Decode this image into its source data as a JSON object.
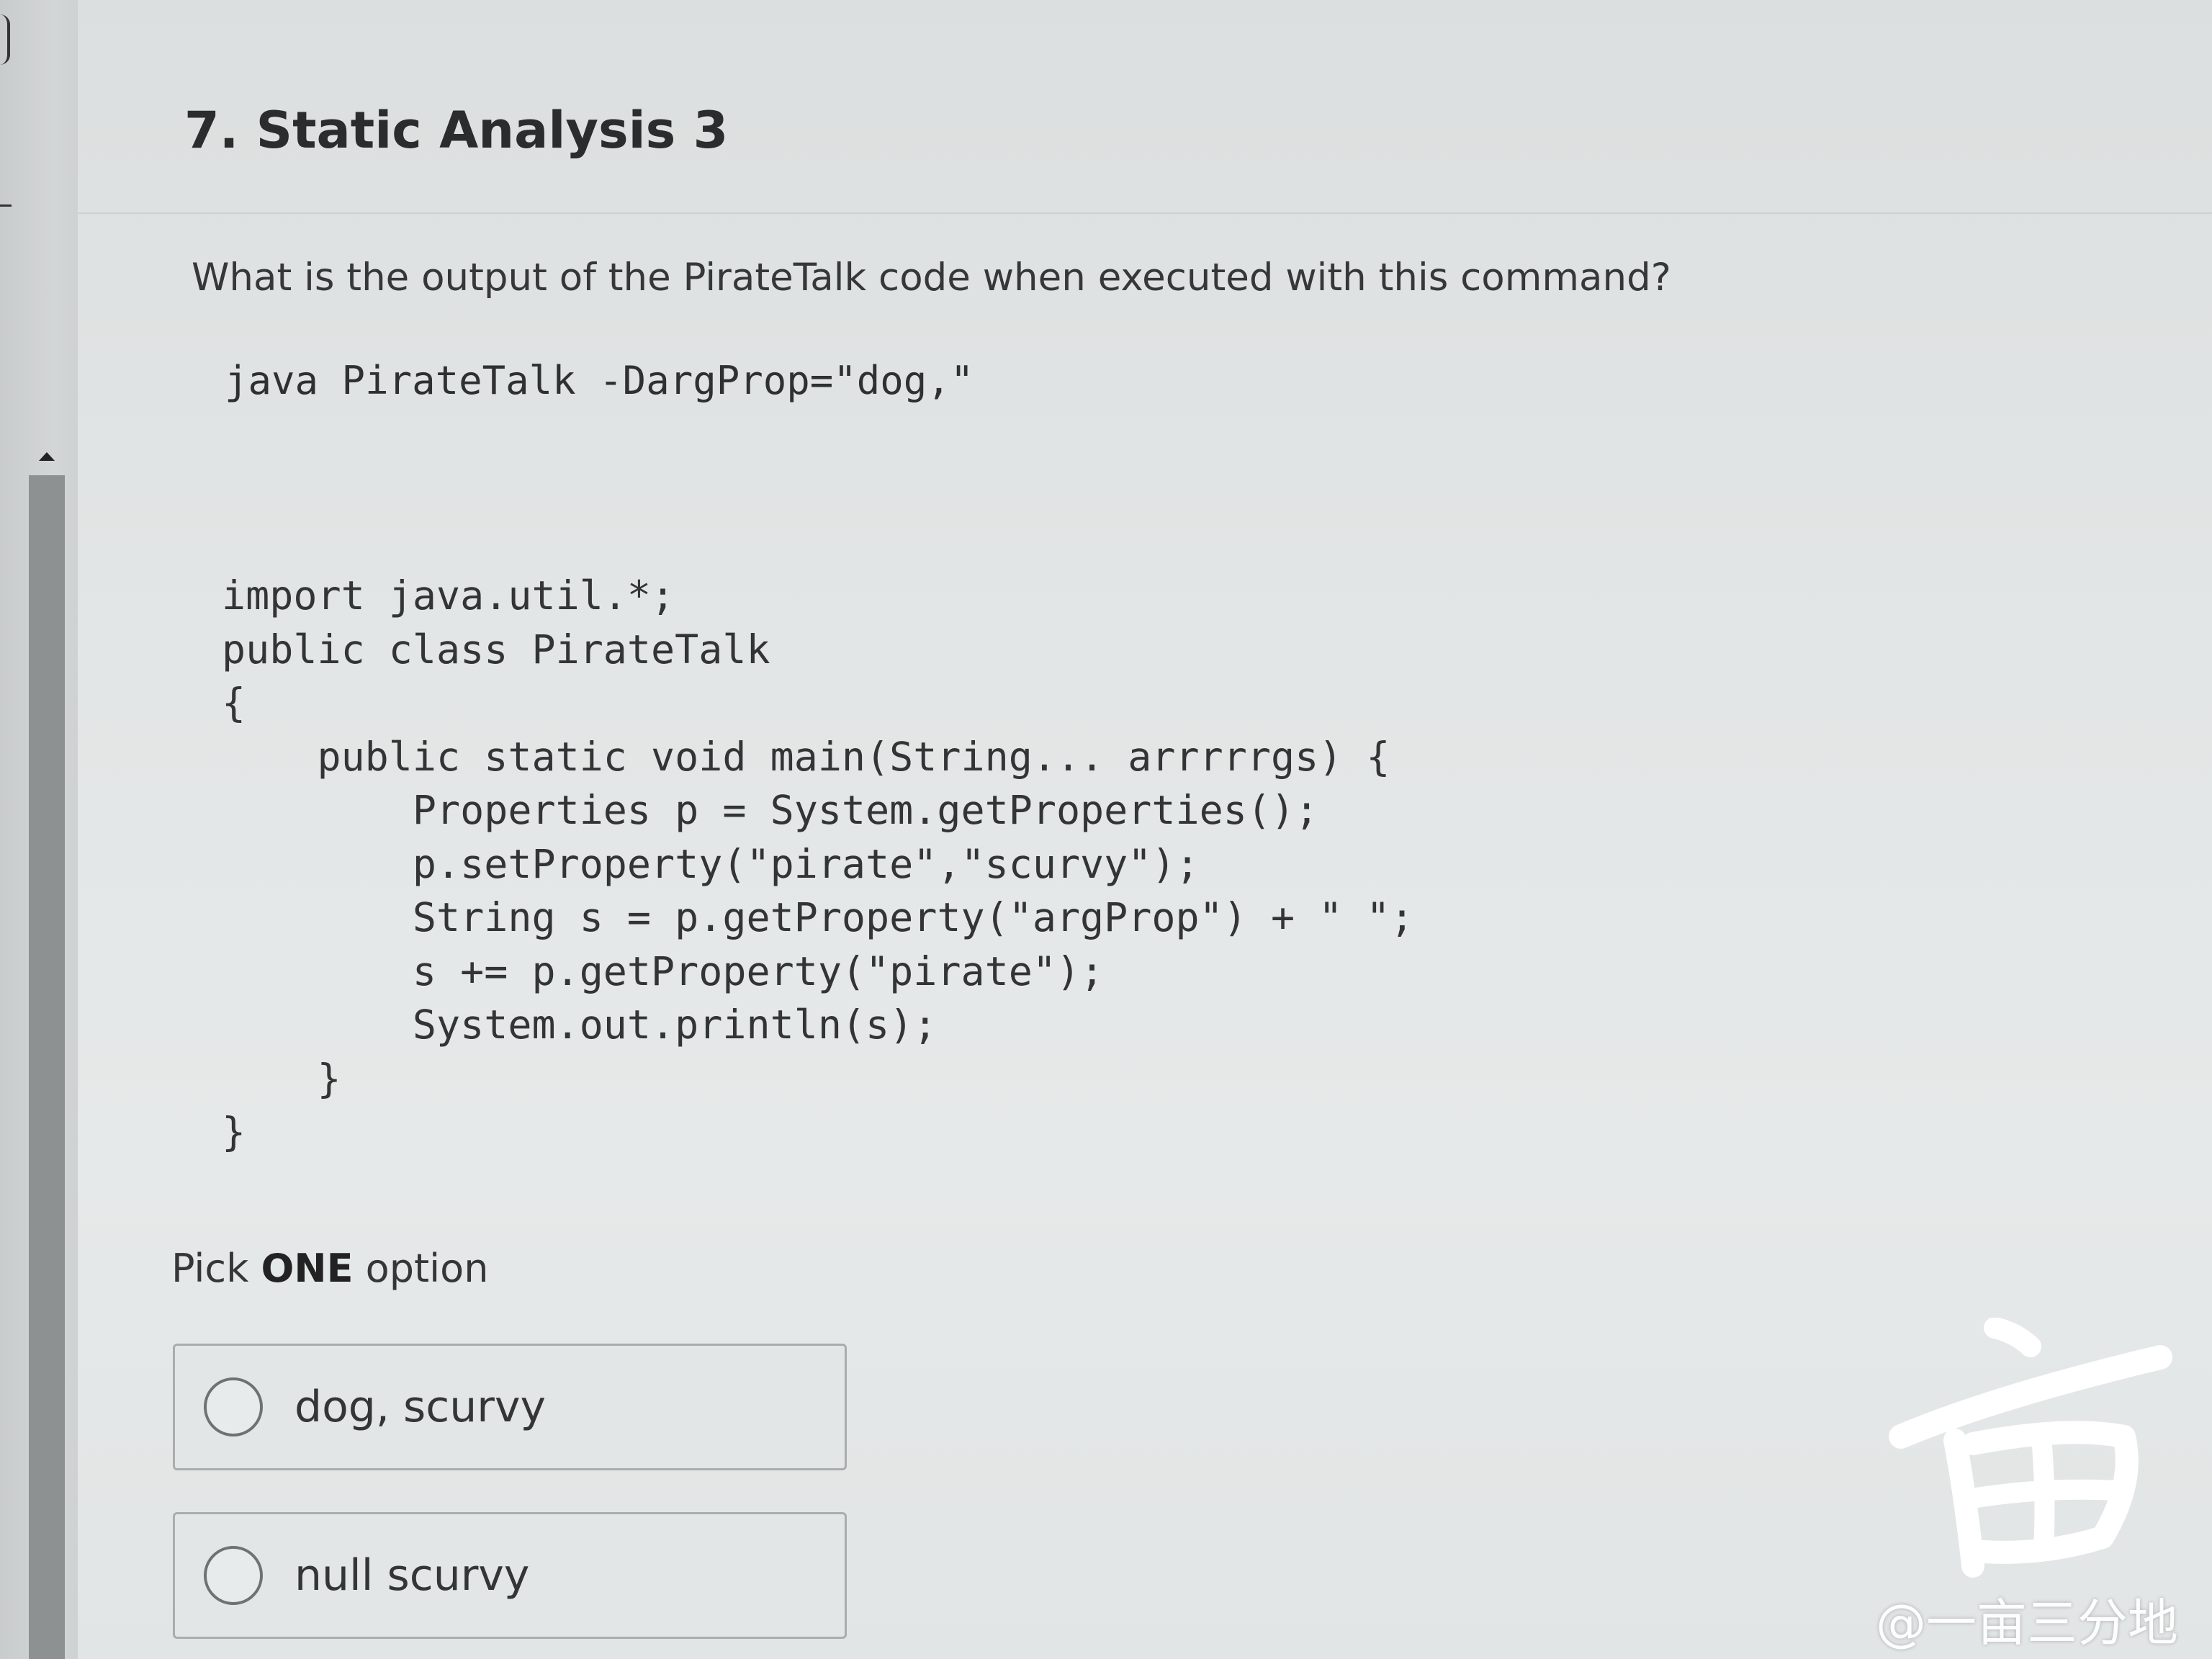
{
  "question": {
    "title": "7. Static Analysis 3",
    "prompt": "What is the output of the PirateTalk code when executed with this command?",
    "command": "java PirateTalk -DargProp=\"dog,\"",
    "code_lines": [
      "import java.util.*;",
      "public class PirateTalk",
      "{",
      "    public static void main(String... arrrrrgs) {",
      "        Properties p = System.getProperties();",
      "        p.setProperty(\"pirate\",\"scurvy\");",
      "        String s = p.getProperty(\"argProp\") + \" \";",
      "        s += p.getProperty(\"pirate\");",
      "        System.out.println(s);",
      "    }",
      "}"
    ]
  },
  "instructions": {
    "pick_prefix": "Pick ",
    "pick_emphasis": "ONE",
    "pick_suffix": " option"
  },
  "options": [
    {
      "label": "dog, scurvy",
      "selected": false
    },
    {
      "label": "null scurvy",
      "selected": false
    }
  ],
  "watermark": {
    "text": "@一亩三分地"
  },
  "colors": {
    "background": "#e3e6e6",
    "text": "#333536",
    "option_border": "#a9adad",
    "scrollbar": "#8d9191"
  }
}
